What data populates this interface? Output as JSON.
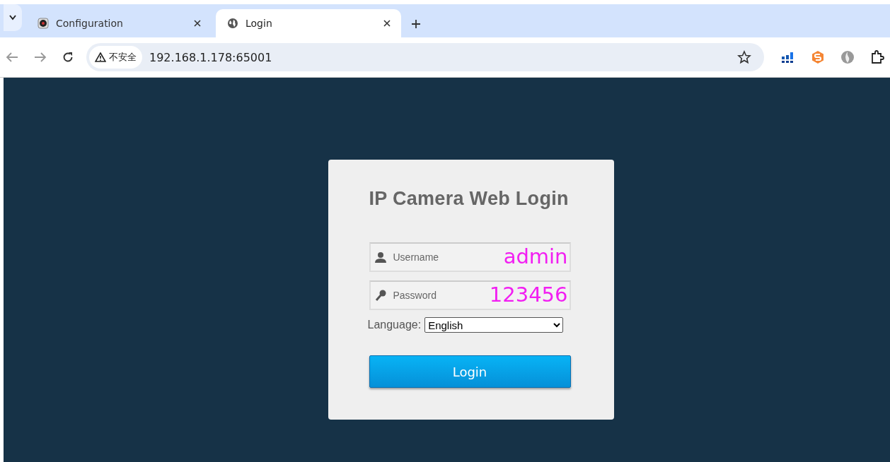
{
  "tabs": [
    {
      "title": "Configuration",
      "kind": "camera",
      "selected": false
    },
    {
      "title": "Login",
      "kind": "globe",
      "selected": true
    }
  ],
  "address_bar": {
    "security_label": "不安全",
    "url": "192.168.1.178:65001"
  },
  "login": {
    "title": "IP Camera Web Login",
    "fields": [
      {
        "kind": "user",
        "placeholder": "Username",
        "annotation": "admin"
      },
      {
        "kind": "password",
        "placeholder": "Password",
        "annotation": "123456"
      }
    ],
    "language_label": "Language:",
    "language": "English",
    "button": "Login"
  }
}
